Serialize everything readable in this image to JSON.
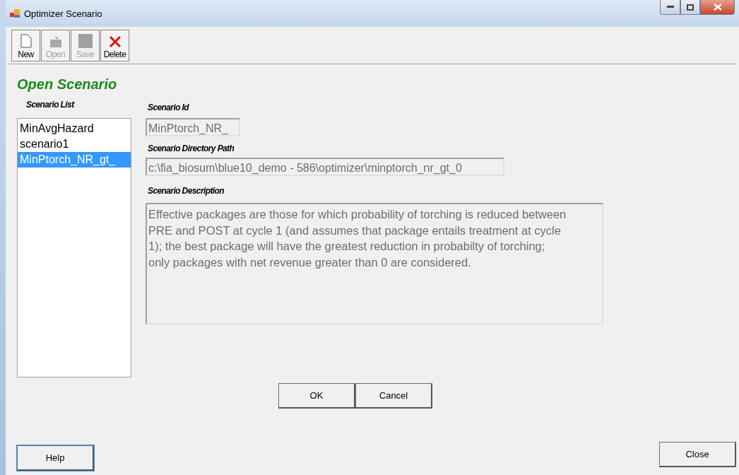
{
  "window": {
    "title": "Optimizer Scenario"
  },
  "toolbar": [
    {
      "label": "New",
      "kind": "new",
      "disabled": false
    },
    {
      "label": "Open",
      "kind": "open",
      "disabled": true
    },
    {
      "label": "Save",
      "kind": "save",
      "disabled": true
    },
    {
      "label": "Delete",
      "kind": "delete",
      "disabled": false
    }
  ],
  "heading": "Open Scenario",
  "scenario_list": {
    "label": "Scenario List",
    "items": [
      {
        "text": "MinAvgHazard",
        "selected": false
      },
      {
        "text": "scenario1",
        "selected": false
      },
      {
        "text": "MinPtorch_NR_gt_",
        "selected": true
      }
    ]
  },
  "scenario_id": {
    "label": "Scenario Id",
    "value": "MinPtorch_NR_"
  },
  "directory_path": {
    "label": "Scenario Directory Path",
    "value": "c:\\fia_biosum\\blue10_demo - 586\\optimizer\\minptorch_nr_gt_0"
  },
  "description": {
    "label": "Scenario Description",
    "value": "Effective packages are those for which probability of torching is reduced between PRE and POST at cycle 1 (and assumes that package entails treatment at cycle 1); the best package will have the greatest reduction in probabilty of torching; only packages with net revenue greater than 0 are considered."
  },
  "buttons": {
    "ok": "OK",
    "cancel": "Cancel",
    "help": "Help",
    "close": "Close"
  }
}
